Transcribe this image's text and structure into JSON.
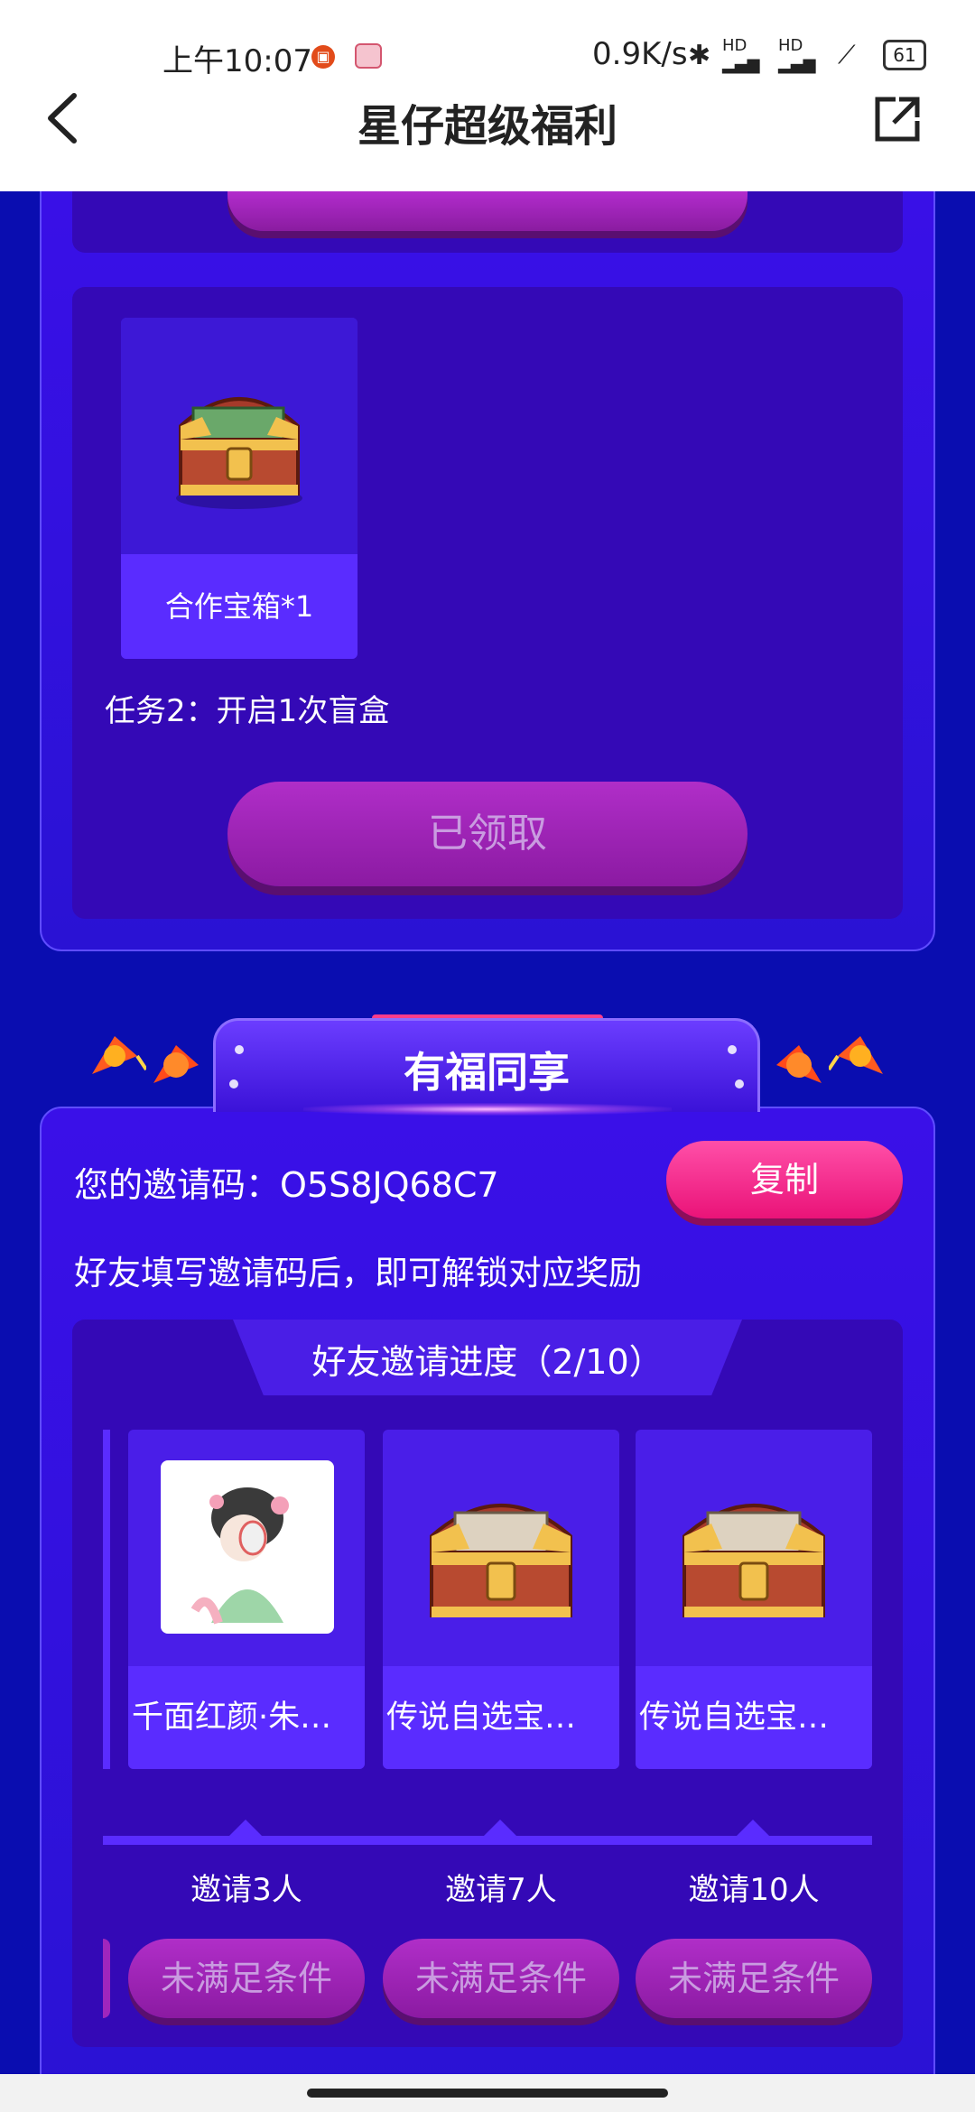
{
  "status_bar": {
    "time": "上午10:07",
    "network_speed": "0.9K/s",
    "bluetooth_icon": "✱",
    "hd_signal_1": "HD",
    "hd_signal_2": "HD",
    "battery": "61"
  },
  "header": {
    "title": "星仔超级福利",
    "back_icon": "chevron-left-icon",
    "share_icon": "external-link-icon"
  },
  "task_panel": {
    "reward_label": "合作宝箱*1",
    "task_text": "任务2：开启1次盲盒",
    "claim_button": "已领取"
  },
  "invite_section": {
    "banner_title": "有福同享",
    "invite_code_text": "您的邀请码：O5S8JQ68C7",
    "copy_button": "复制",
    "hint_text": "好友填写邀请码后，即可解锁对应奖励",
    "progress_title": "好友邀请进度（2/10）",
    "rewards": [
      {
        "label": "千面红颜·朱…",
        "invite_count": "邀请3人",
        "button": "未满足条件"
      },
      {
        "label": "传说自选宝…",
        "invite_count": "邀请7人",
        "button": "未满足条件"
      },
      {
        "label": "传说自选宝…",
        "invite_count": "邀请10人",
        "button": "未满足条件"
      }
    ]
  },
  "colors": {
    "background": "#0a0db0",
    "panel": "#3409b6",
    "card": "#5a2cff",
    "copy_button": "#ff4fa8",
    "disabled_button": "#9f26bd"
  }
}
